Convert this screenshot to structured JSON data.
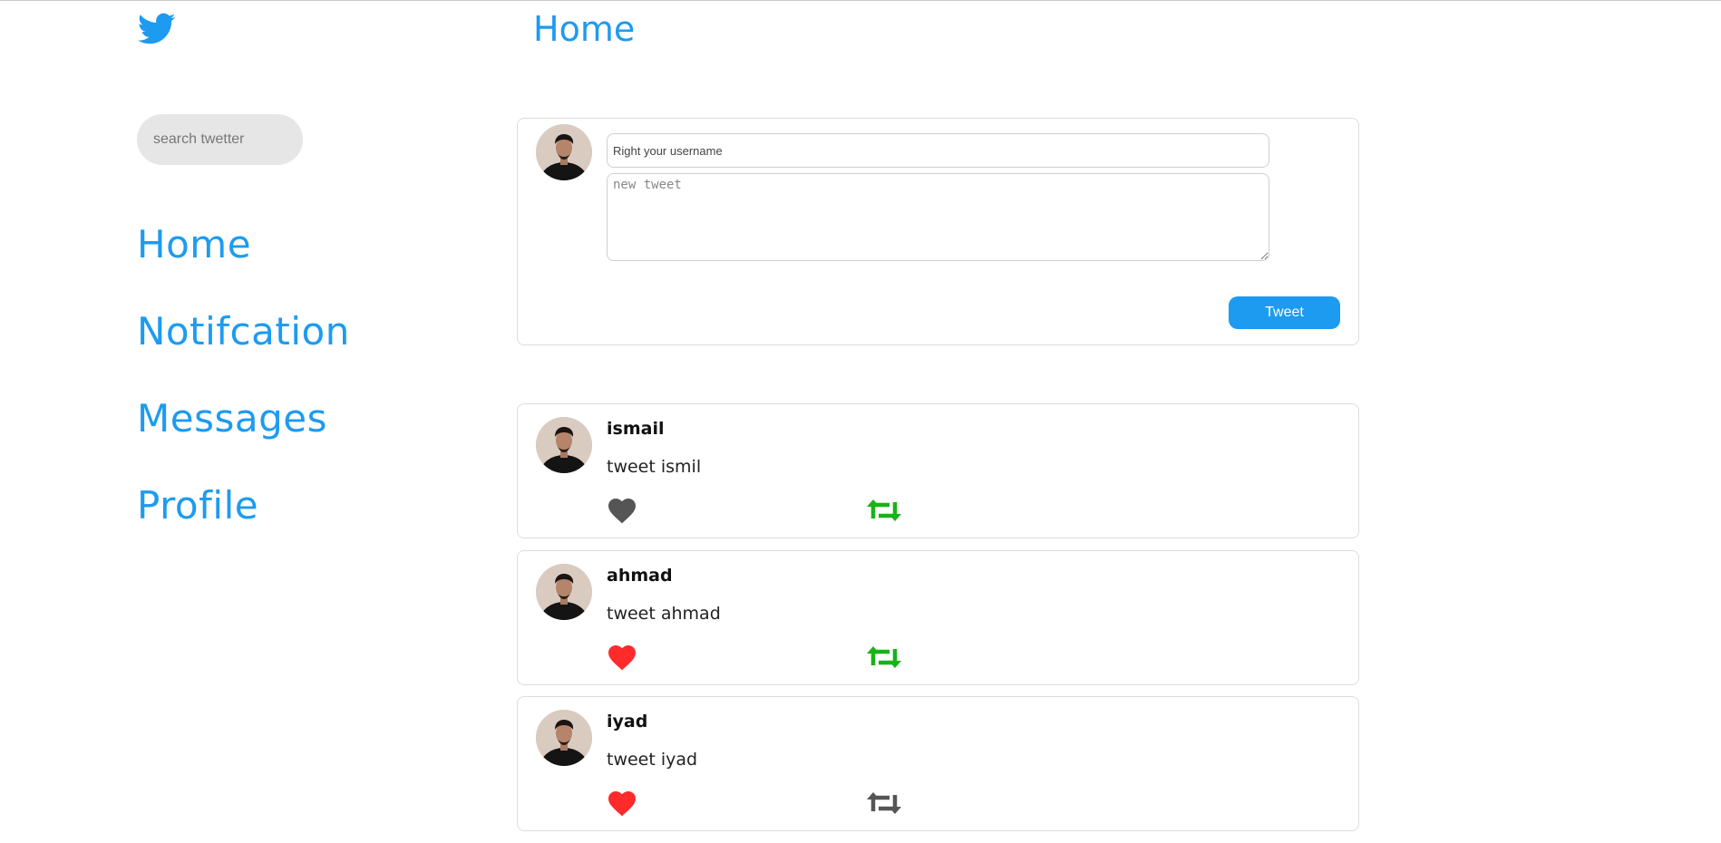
{
  "header": {
    "title": "Home"
  },
  "sidebar": {
    "logo": "twitter-bird-icon",
    "search_placeholder": "search twetter",
    "items": [
      {
        "label": "Home"
      },
      {
        "label": "Notifcation"
      },
      {
        "label": "Messages"
      },
      {
        "label": "Profile"
      }
    ]
  },
  "composer": {
    "username_placeholder": "Right your username",
    "tweet_placeholder": "new tweet",
    "tweet_button": "Tweet"
  },
  "tweets": [
    {
      "username": "ismail",
      "text": "tweet ismil",
      "liked": false,
      "retweeted": true
    },
    {
      "username": "ahmad",
      "text": "tweet ahmad",
      "liked": true,
      "retweeted": true
    },
    {
      "username": "iyad",
      "text": "tweet iyad",
      "liked": true,
      "retweeted": false
    }
  ],
  "colors": {
    "accent": "#1d9bf0",
    "like_active": "#ff2a2a",
    "like_inactive": "#555555",
    "retweet_active": "#17b317",
    "retweet_inactive": "#555555"
  }
}
